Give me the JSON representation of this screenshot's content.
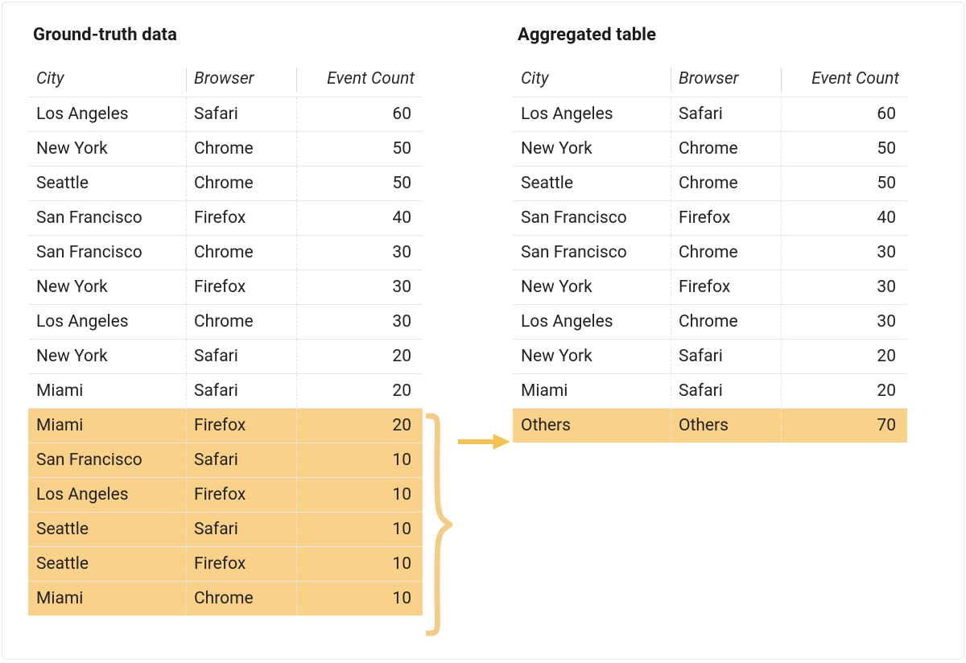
{
  "colors": {
    "highlight": "#f9d188",
    "arrow": "#f3c252",
    "brace": "#f3cd86"
  },
  "left": {
    "title": "Ground-truth data",
    "columns": {
      "c1": "City",
      "c2": "Browser",
      "c3": "Event Count"
    },
    "rows": [
      {
        "city": "Los Angeles",
        "browser": "Safari",
        "count": 60,
        "hl": false
      },
      {
        "city": "New York",
        "browser": "Chrome",
        "count": 50,
        "hl": false
      },
      {
        "city": "Seattle",
        "browser": "Chrome",
        "count": 50,
        "hl": false
      },
      {
        "city": "San Francisco",
        "browser": "Firefox",
        "count": 40,
        "hl": false
      },
      {
        "city": "San Francisco",
        "browser": "Chrome",
        "count": 30,
        "hl": false
      },
      {
        "city": "New York",
        "browser": "Firefox",
        "count": 30,
        "hl": false
      },
      {
        "city": "Los Angeles",
        "browser": "Chrome",
        "count": 30,
        "hl": false
      },
      {
        "city": "New York",
        "browser": "Safari",
        "count": 20,
        "hl": false
      },
      {
        "city": "Miami",
        "browser": "Safari",
        "count": 20,
        "hl": false
      },
      {
        "city": "Miami",
        "browser": "Firefox",
        "count": 20,
        "hl": true
      },
      {
        "city": "San Francisco",
        "browser": "Safari",
        "count": 10,
        "hl": true
      },
      {
        "city": "Los Angeles",
        "browser": "Firefox",
        "count": 10,
        "hl": true
      },
      {
        "city": "Seattle",
        "browser": "Safari",
        "count": 10,
        "hl": true
      },
      {
        "city": "Seattle",
        "browser": "Firefox",
        "count": 10,
        "hl": true
      },
      {
        "city": "Miami",
        "browser": "Chrome",
        "count": 10,
        "hl": true
      }
    ]
  },
  "right": {
    "title": "Aggregated table",
    "columns": {
      "c1": "City",
      "c2": "Browser",
      "c3": "Event Count"
    },
    "rows": [
      {
        "city": "Los Angeles",
        "browser": "Safari",
        "count": 60,
        "hl": false
      },
      {
        "city": "New York",
        "browser": "Chrome",
        "count": 50,
        "hl": false
      },
      {
        "city": "Seattle",
        "browser": "Chrome",
        "count": 50,
        "hl": false
      },
      {
        "city": "San Francisco",
        "browser": "Firefox",
        "count": 40,
        "hl": false
      },
      {
        "city": "San Francisco",
        "browser": "Chrome",
        "count": 30,
        "hl": false
      },
      {
        "city": "New York",
        "browser": "Firefox",
        "count": 30,
        "hl": false
      },
      {
        "city": "Los Angeles",
        "browser": "Chrome",
        "count": 30,
        "hl": false
      },
      {
        "city": "New York",
        "browser": "Safari",
        "count": 20,
        "hl": false
      },
      {
        "city": "Miami",
        "browser": "Safari",
        "count": 20,
        "hl": false
      },
      {
        "city": "Others",
        "browser": "Others",
        "count": 70,
        "hl": true
      }
    ]
  }
}
